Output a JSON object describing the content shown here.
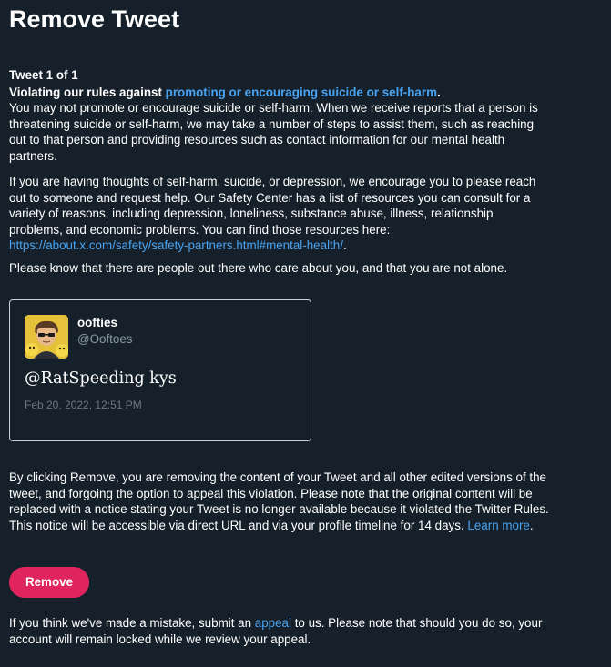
{
  "page": {
    "title": "Remove Tweet"
  },
  "notice": {
    "counter": "Tweet 1 of 1",
    "rule_prefix": "Violating our rules against ",
    "rule_link": "promoting or encouraging suicide or self-harm",
    "rule_suffix": ".",
    "rule_description": "You may not promote or encourage suicide or self-harm. When we receive reports that a person is threatening suicide or self-harm, we may take a number of steps to assist them, such as reaching out to that person and providing resources such as contact information for our mental health partners.",
    "help_text": "If you are having thoughts of self-harm, suicide, or depression, we encourage you to please reach out to someone and request help. Our Safety Center has a list of resources you can consult for a variety of reasons, including depression, loneliness, substance abuse, illness, relationship problems, and economic problems. You can find those resources here:",
    "help_link": "https://about.x.com/safety/safety-partners.html#mental-health/",
    "help_suffix": ".",
    "care_text": "Please know that there are people out there who care about you, and that you are not alone."
  },
  "tweet": {
    "display_name": "oofties",
    "handle": "@Ooftoes",
    "text": "@RatSpeeding kys",
    "timestamp": "Feb 20, 2022, 12:51 PM"
  },
  "removal": {
    "info_text": "By clicking Remove, you are removing the content of your Tweet and all other edited versions of the tweet, and forgoing the option to appeal this violation. Please note that the original content will be replaced with a notice stating your Tweet is no longer available because it violated the Twitter Rules. This notice will be accessible via direct URL and via your profile timeline for 14 days.",
    "learn_more": "Learn more",
    "learn_more_suffix": ".",
    "button_label": "Remove"
  },
  "appeal": {
    "prefix": "If you think we've made a mistake, submit an ",
    "link": "appeal",
    "suffix": " to us. Please note that should you do so, your account will remain locked while we review your appeal."
  },
  "colors": {
    "background": "#15202b",
    "link": "#4aa3f0",
    "button": "#e0245e",
    "muted": "#8b98a5"
  }
}
